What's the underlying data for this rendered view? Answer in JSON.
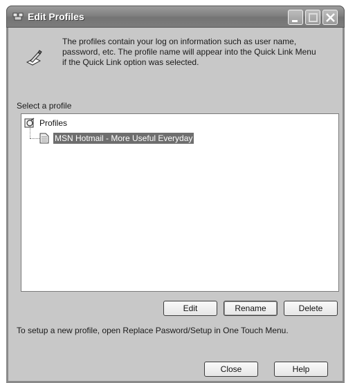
{
  "window": {
    "title": "Edit Profiles"
  },
  "intro": {
    "text": "The profiles contain your log on information such as user name, password, etc. The profile name will appear into the Quick Link Menu if the Quick Link option was selected."
  },
  "profiles": {
    "select_label": "Select a profile",
    "root_label": "Profiles",
    "items": [
      {
        "label": "MSN Hotmail - More Useful Everyday",
        "selected": true
      }
    ]
  },
  "actions": {
    "edit": "Edit",
    "rename": "Rename",
    "delete": "Delete"
  },
  "setup_note": "To setup a new profile, open Replace Pasword/Setup in One Touch Menu.",
  "footer": {
    "close": "Close",
    "help": "Help"
  }
}
